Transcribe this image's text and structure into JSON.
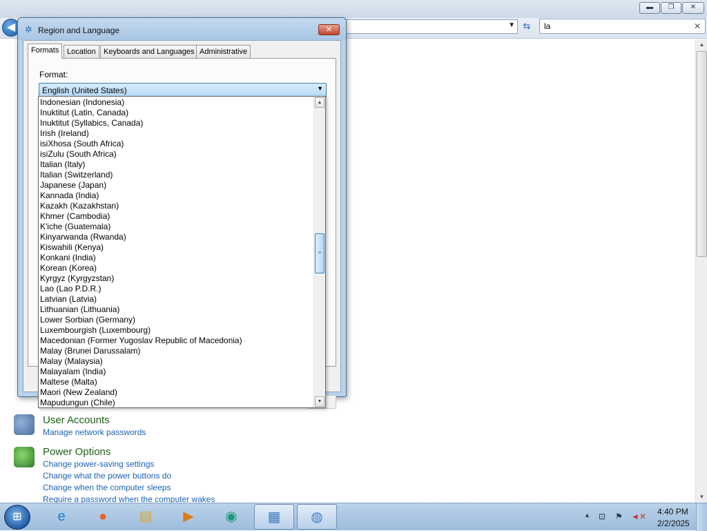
{
  "explorer": {
    "search_value": "la",
    "search_clear": "✕",
    "back_glyph": "◀",
    "refresh_glyph": "⇆",
    "minimize_glyph": "▬",
    "restore_glyph": "❐",
    "close_glyph": "✕",
    "sections": [
      {
        "heading": "User Accounts",
        "icon": "users-icon",
        "links": [
          "Manage network passwords"
        ]
      },
      {
        "heading": "Power Options",
        "icon": "power-options-icon",
        "links": [
          "Change power-saving settings",
          "Change what the power buttons do",
          "Change when the computer sleeps",
          "Require a password when the computer wakes"
        ]
      }
    ]
  },
  "dialog": {
    "title": "Region and Language",
    "close_glyph": "✕",
    "tabs": [
      "Formats",
      "Location",
      "Keyboards and Languages",
      "Administrative"
    ],
    "active_tab": 0,
    "format_label": "Format:",
    "format_selected": "English (United States)",
    "dropdown_arrow": "▼",
    "format_options": [
      "Indonesian (Indonesia)",
      "Inuktitut (Latin, Canada)",
      "Inuktitut (Syllabics, Canada)",
      "Irish (Ireland)",
      "isiXhosa (South Africa)",
      "isiZulu (South Africa)",
      "Italian (Italy)",
      "Italian (Switzerland)",
      "Japanese (Japan)",
      "Kannada (India)",
      "Kazakh (Kazakhstan)",
      "Khmer (Cambodia)",
      "K'iche (Guatemala)",
      "Kinyarwanda (Rwanda)",
      "Kiswahili (Kenya)",
      "Konkani (India)",
      "Korean (Korea)",
      "Kyrgyz (Kyrgyzstan)",
      "Lao (Lao P.D.R.)",
      "Latvian (Latvia)",
      "Lithuanian (Lithuania)",
      "Lower Sorbian (Germany)",
      "Luxembourgish (Luxembourg)",
      "Macedonian (Former Yugoslav Republic of Macedonia)",
      "Malay (Brunei Darussalam)",
      "Malay (Malaysia)",
      "Malayalam (India)",
      "Maltese (Malta)",
      "Maori (New Zealand)",
      "Mapudungun (Chile)"
    ]
  },
  "taskbar": {
    "start_glyph": "⊞",
    "apps": [
      {
        "name": "internet-explorer-icon",
        "glyph": "e",
        "color": "#1d7fd1"
      },
      {
        "name": "firefox-icon",
        "glyph": "●",
        "color": "#e8641c"
      },
      {
        "name": "windows-explorer-icon",
        "glyph": "▤",
        "color": "#d9a630"
      },
      {
        "name": "media-player-icon",
        "glyph": "▶",
        "color": "#e07a16"
      },
      {
        "name": "app-icon",
        "glyph": "◉",
        "color": "#1d9a7a"
      },
      {
        "name": "control-panel-icon",
        "glyph": "▦",
        "color": "#3f7fc1"
      },
      {
        "name": "region-language-icon",
        "glyph": "◍",
        "color": "#3d7ed0"
      }
    ],
    "tray_arrow": "▲",
    "time": "4:40 PM",
    "date": "2/2/2025"
  }
}
